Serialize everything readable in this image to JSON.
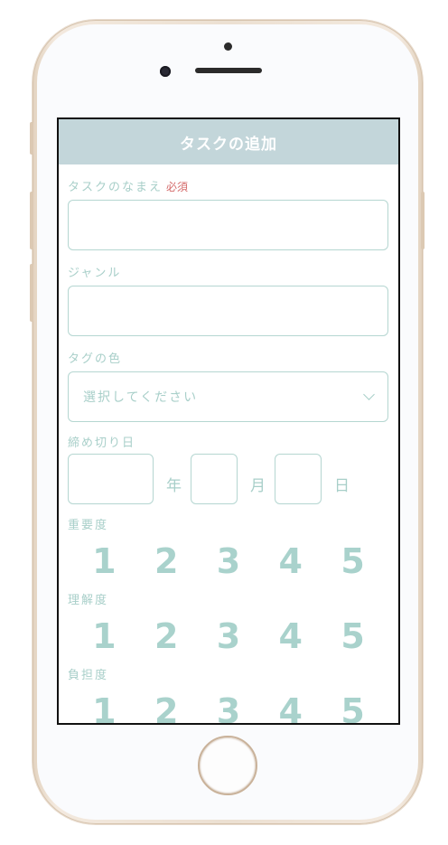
{
  "header": {
    "title": "タスクの追加"
  },
  "form": {
    "task_name": {
      "label": "タスクのなまえ",
      "required": "必須",
      "value": ""
    },
    "genre": {
      "label": "ジャンル",
      "value": ""
    },
    "tag_color": {
      "label": "タグの色",
      "selected": "選択してください"
    },
    "deadline": {
      "label": "締め切り日",
      "year_unit": "年",
      "month_unit": "月",
      "day_unit": "日"
    },
    "importance": {
      "label": "重要度",
      "options": [
        "1",
        "2",
        "3",
        "4",
        "5"
      ]
    },
    "understanding": {
      "label": "理解度",
      "options": [
        "1",
        "2",
        "3",
        "4",
        "5"
      ]
    },
    "burden": {
      "label": "負担度",
      "options": [
        "1",
        "2",
        "3",
        "4",
        "5"
      ]
    }
  },
  "icons": {
    "select_arrow": "chevron-down-icon"
  },
  "colors": {
    "header_bg": "#c3d6da",
    "accent": "#a8cfc9",
    "required": "#d46a6a"
  }
}
